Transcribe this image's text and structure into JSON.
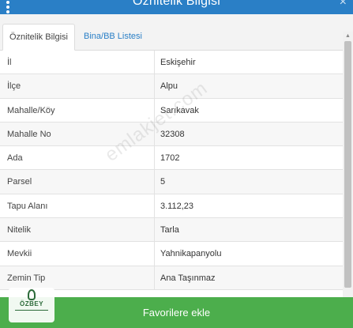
{
  "header": {
    "title": "Öznitelik Bilgisi"
  },
  "tabs": [
    {
      "label": "Öznitelik Bilgisi"
    },
    {
      "label": "Bina/BB Listesi"
    }
  ],
  "rows": [
    {
      "key": "İl",
      "value": "Eskişehir"
    },
    {
      "key": "İlçe",
      "value": "Alpu"
    },
    {
      "key": "Mahalle/Köy",
      "value": "Sarıkavak"
    },
    {
      "key": "Mahalle No",
      "value": "32308"
    },
    {
      "key": "Ada",
      "value": "1702"
    },
    {
      "key": "Parsel",
      "value": "5"
    },
    {
      "key": "Tapu Alanı",
      "value": "3.112,23"
    },
    {
      "key": "Nitelik",
      "value": "Tarla"
    },
    {
      "key": "Mevkii",
      "value": "Yahnikapanyolu"
    },
    {
      "key": "Zemin Tip",
      "value": "Ana Taşınmaz"
    }
  ],
  "footer": {
    "button_label": "Favorilere ekle"
  },
  "watermark": {
    "text": "emlakjet.com"
  },
  "logo": {
    "text": "ÖZBEY"
  },
  "colors": {
    "header": "#2a7fc6",
    "button": "#4cae4c"
  }
}
